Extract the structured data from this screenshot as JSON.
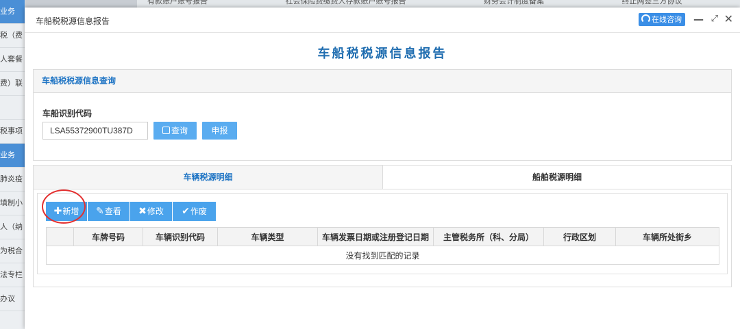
{
  "background": {
    "sidebar_items": [
      "业务",
      "税（费",
      "人套餐",
      "费）联",
      "",
      "税事项",
      "业务",
      "肺炎疫",
      "填制小",
      "人（纳",
      "为税合",
      "法专栏",
      "办议"
    ],
    "top_links": [
      "有款账户账号报告",
      "社会保险费缴费人存款账户账号报告",
      "财务会计制度备案",
      "终止网签三方协议"
    ]
  },
  "window": {
    "title": "车船税税源信息报告",
    "consult_label": "在线咨询",
    "minimize_glyph": "—",
    "maximize_glyph": "⤢",
    "close_glyph": "✕"
  },
  "report": {
    "title": "车船税税源信息报告"
  },
  "query_panel": {
    "heading": "车船税税源信息查询",
    "field_label": "车船识别代码",
    "vin_value": "LSA55372900TU387D",
    "query_label": "查询",
    "declare_label": "申报"
  },
  "detail_panel": {
    "tabs": [
      {
        "label": "车辆税源明细",
        "active": true
      },
      {
        "label": "船舶税源明细",
        "active": false
      }
    ],
    "toolbar": {
      "add_label": "新增",
      "view_label": "查看",
      "edit_label": "修改",
      "void_label": "作废"
    },
    "columns": [
      "",
      "车牌号码",
      "车辆识别代码",
      "车辆类型",
      "车辆发票日期或注册登记日期",
      "主管税务所（科、分局）",
      "行政区划",
      "车辆所处街乡"
    ],
    "empty_message": "没有找到匹配的记录"
  },
  "colors": {
    "accent": "#1e74c4",
    "button": "#5aacf0",
    "annotation": "#e33030"
  }
}
